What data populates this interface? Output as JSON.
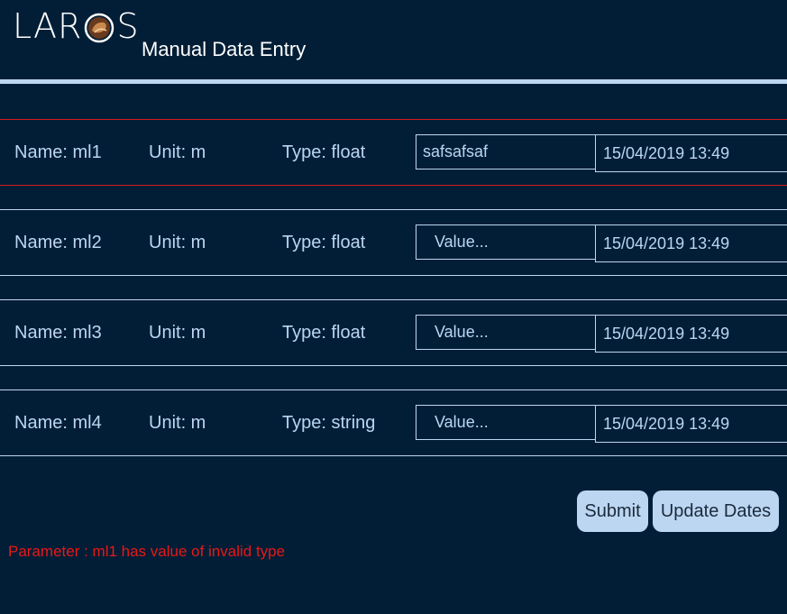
{
  "header": {
    "logo_left": "LAR",
    "logo_right": "S",
    "title": "Manual Data Entry"
  },
  "parameters": [
    {
      "name": "Name: ml1",
      "unit": "Unit: m",
      "type": "Type: float",
      "value": "safsafsaf",
      "placeholder": "Value...",
      "date": "15/04/2019 13:49",
      "invalid": true
    },
    {
      "name": "Name: ml2",
      "unit": "Unit: m",
      "type": "Type: float",
      "value": "",
      "placeholder": "Value...",
      "date": "15/04/2019 13:49",
      "invalid": false
    },
    {
      "name": "Name: ml3",
      "unit": "Unit: m",
      "type": "Type: float",
      "value": "",
      "placeholder": "Value...",
      "date": "15/04/2019 13:49",
      "invalid": false
    },
    {
      "name": "Name: ml4",
      "unit": "Unit: m",
      "type": "Type: string",
      "value": "",
      "placeholder": "Value...",
      "date": "15/04/2019 13:49",
      "invalid": false
    }
  ],
  "actions": {
    "submit_label": "Submit",
    "update_dates_label": "Update Dates"
  },
  "error_message": "Parameter : ml1 has value of invalid type",
  "colors": {
    "background": "#021e36",
    "text": "#bcd6f2",
    "error": "#e81818",
    "button": "#bcd6f2"
  }
}
